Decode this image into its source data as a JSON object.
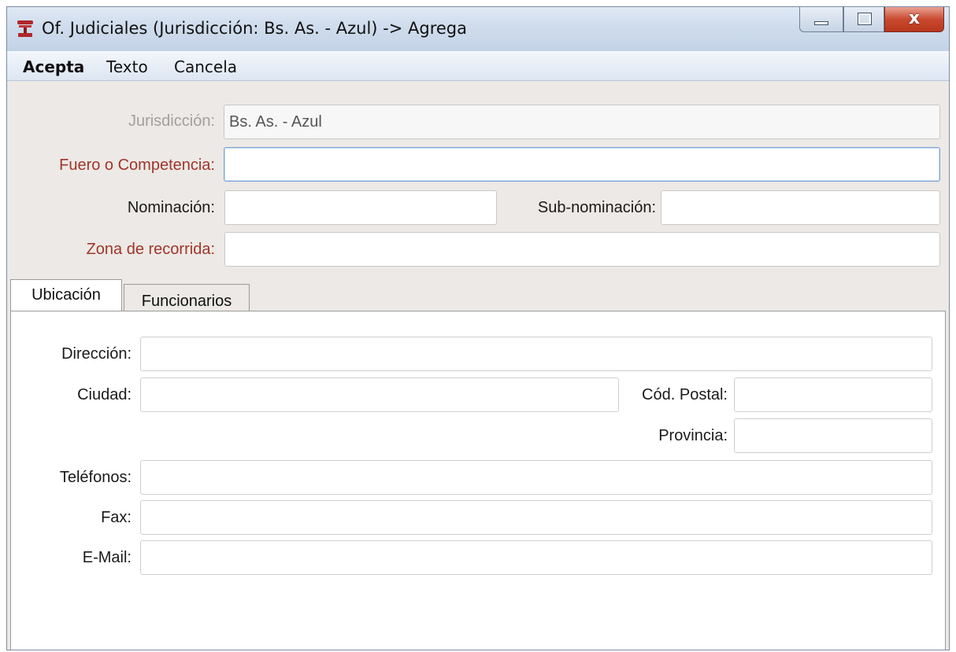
{
  "window": {
    "title": "Of. Judiciales (Jurisdicción: Bs. As. - Azul) -> Agrega",
    "app_icon": "gavel-icon",
    "close_glyph": "x"
  },
  "menu": {
    "acepta": "Acepta",
    "texto": "Texto",
    "cancela": "Cancela"
  },
  "form": {
    "jurisdiccion_label": "Jurisdicción:",
    "jurisdiccion_value": "Bs. As. - Azul",
    "fuero_label": "Fuero o Competencia:",
    "fuero_value": "",
    "nominacion_label": "Nominación:",
    "nominacion_value": "",
    "subnominacion_label": "Sub-nominación:",
    "subnominacion_value": "",
    "zona_label": "Zona de recorrida:",
    "zona_value": ""
  },
  "tabs": {
    "ubicacion": "Ubicación",
    "funcionarios": "Funcionarios"
  },
  "ubicacion": {
    "direccion_label": "Dirección:",
    "ciudad_label": "Ciudad:",
    "cod_postal_label": "Cód. Postal:",
    "provincia_label": "Provincia:",
    "telefonos_label": "Teléfonos:",
    "fax_label": "Fax:",
    "email_label": "E-Mail:"
  },
  "colors": {
    "required_label": "#a0352a",
    "disabled_label": "#a0a0a0",
    "form_background": "#ece9e6",
    "close_button": "#c94a30"
  }
}
